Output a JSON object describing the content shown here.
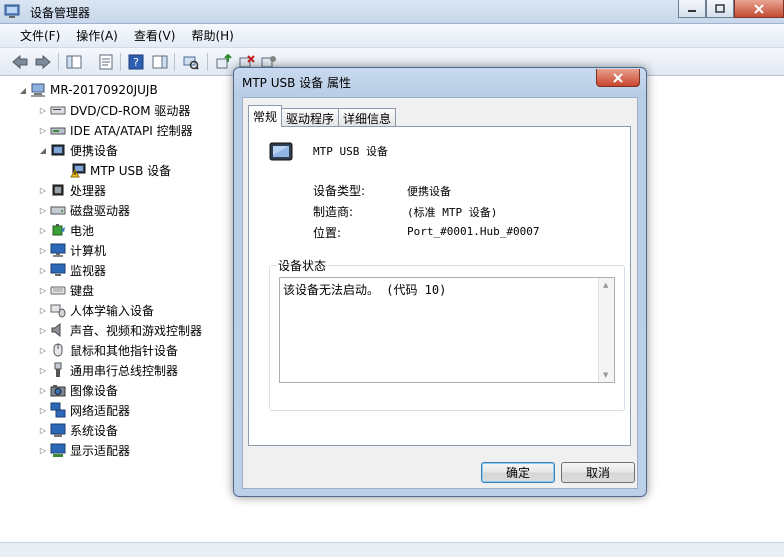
{
  "window": {
    "title": "设备管理器"
  },
  "menu": [
    "文件(F)",
    "操作(A)",
    "查看(V)",
    "帮助(H)"
  ],
  "tree": {
    "root": "MR-20170920JUJB",
    "nodes": [
      {
        "label": "DVD/CD-ROM 驱动器",
        "icon": "dvd-drive-icon",
        "expanded": false
      },
      {
        "label": "IDE ATA/ATAPI 控制器",
        "icon": "ide-controller-icon",
        "expanded": false
      },
      {
        "label": "便携设备",
        "icon": "portable-device-icon",
        "expanded": true,
        "children": [
          {
            "label": "MTP USB 设备",
            "icon": "mtp-warning-icon"
          }
        ]
      },
      {
        "label": "处理器",
        "icon": "processor-icon",
        "expanded": false
      },
      {
        "label": "磁盘驱动器",
        "icon": "disk-drive-icon",
        "expanded": false
      },
      {
        "label": "电池",
        "icon": "battery-icon",
        "expanded": false
      },
      {
        "label": "计算机",
        "icon": "computer-icon",
        "expanded": false
      },
      {
        "label": "监视器",
        "icon": "monitor-icon",
        "expanded": false
      },
      {
        "label": "键盘",
        "icon": "keyboard-icon",
        "expanded": false
      },
      {
        "label": "人体学输入设备",
        "icon": "hid-icon",
        "expanded": false
      },
      {
        "label": "声音、视频和游戏控制器",
        "icon": "speaker-icon",
        "expanded": false
      },
      {
        "label": "鼠标和其他指针设备",
        "icon": "mouse-icon",
        "expanded": false
      },
      {
        "label": "通用串行总线控制器",
        "icon": "usb-icon",
        "expanded": false
      },
      {
        "label": "图像设备",
        "icon": "camera-icon",
        "expanded": false
      },
      {
        "label": "网络适配器",
        "icon": "network-adapter-icon",
        "expanded": false
      },
      {
        "label": "系统设备",
        "icon": "system-device-icon",
        "expanded": false
      },
      {
        "label": "显示适配器",
        "icon": "display-adapter-icon",
        "expanded": false
      }
    ]
  },
  "dialog": {
    "title": "MTP USB 设备 属性",
    "tabs": [
      "常规",
      "驱动程序",
      "详细信息"
    ],
    "active_tab": "常规",
    "device_name": "MTP USB 设备",
    "props": [
      {
        "label": "设备类型:",
        "value": "便携设备"
      },
      {
        "label": "制造商:",
        "value": "(标准 MTP 设备)"
      },
      {
        "label": "位置:",
        "value": "Port_#0001.Hub_#0007"
      }
    ],
    "status_group_label": "设备状态",
    "status_text": "该设备无法启动。 (代码 10)",
    "ok_label": "确定",
    "cancel_label": "取消"
  }
}
